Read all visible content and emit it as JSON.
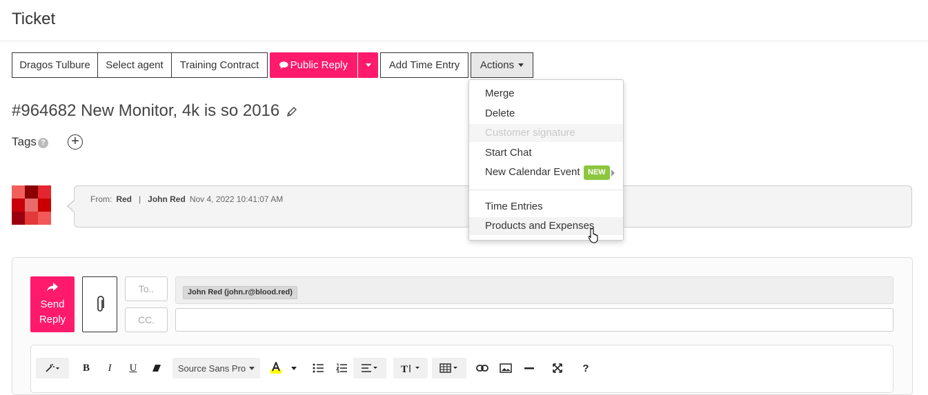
{
  "header": {
    "title": "Ticket"
  },
  "toolbar": {
    "agent": "Dragos Tulbure",
    "select_agent": "Select agent",
    "contract": "Training Contract",
    "public_reply": "Public Reply",
    "add_time_entry": "Add Time Entry",
    "actions": "Actions"
  },
  "ticket": {
    "title": "#964682 New Monitor, 4k is so 2016",
    "tags_label": "Tags",
    "help": "?"
  },
  "message": {
    "from_label": "From:",
    "from_name": "Red",
    "separator": "|",
    "contact": "John Red",
    "date": "Nov 4, 2022 10:41:07 AM"
  },
  "actions_menu": {
    "items": [
      {
        "label": "Merge"
      },
      {
        "label": "Delete"
      },
      {
        "label": "Customer signature",
        "disabled": true
      },
      {
        "label": "Start Chat"
      },
      {
        "label": "New Calendar Event",
        "badge": "NEW"
      },
      {
        "label": "Time Entries"
      },
      {
        "label": "Products and Expenses"
      }
    ]
  },
  "reply": {
    "send_line1": "Send",
    "send_line2": "Reply",
    "to_placeholder": "To..",
    "cc_placeholder": "CC.",
    "to_recipient": "John Red (john.r@blood.red)"
  },
  "editor": {
    "font": "Source Sans Pro",
    "bold": "B",
    "italic": "I",
    "underline": "U",
    "help": "?"
  },
  "colors": {
    "primary": "#ff1a6c",
    "badge_new": "#8cc63e"
  }
}
